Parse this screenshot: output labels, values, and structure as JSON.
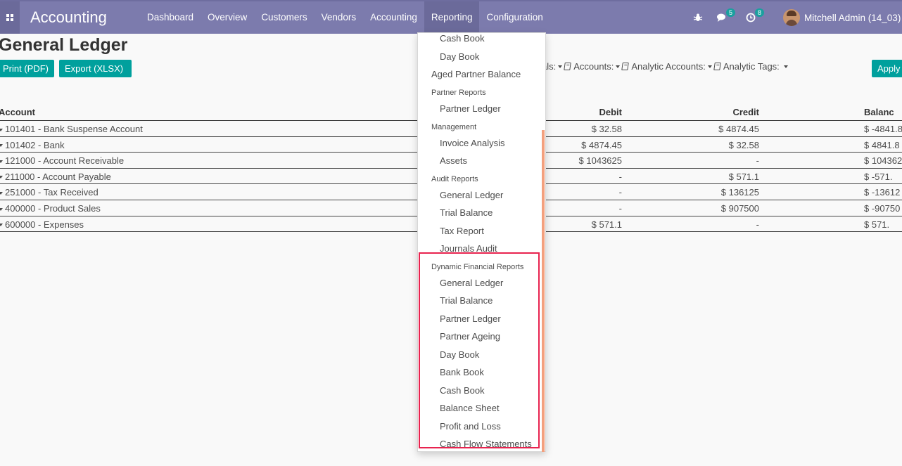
{
  "topbar": {
    "app_title": "Accounting",
    "menu": [
      "Dashboard",
      "Overview",
      "Customers",
      "Vendors",
      "Accounting",
      "Reporting",
      "Configuration"
    ],
    "active_menu": "Reporting",
    "messages_count": "5",
    "activities_count": "8",
    "user_name": "Mitchell Admin (14_03)"
  },
  "page": {
    "title": "General Ledger",
    "print_pdf_label": "Print (PDF)",
    "export_xlsx_label": "Export (XLSX)",
    "apply_label": "Apply",
    "filters": {
      "journals": "als:",
      "accounts": "Accounts:",
      "analytic_accounts": "Analytic Accounts:",
      "analytic_tags": "Analytic Tags:"
    }
  },
  "ledger": {
    "headers": {
      "account": "Account",
      "debit": "Debit",
      "credit": "Credit",
      "balance": "Balanc"
    },
    "rows": [
      {
        "account": "101401 - Bank Suspense Account",
        "debit": "$ 32.58",
        "credit": "$ 4874.45",
        "balance": "$ -4841.8"
      },
      {
        "account": "101402 - Bank",
        "debit": "$ 4874.45",
        "credit": "$ 32.58",
        "balance": "$ 4841.8"
      },
      {
        "account": "121000 - Account Receivable",
        "debit": "$ 1043625",
        "credit": "-",
        "balance": "$ 104362"
      },
      {
        "account": "211000 - Account Payable",
        "debit": "-",
        "credit": "$ 571.1",
        "balance": "$ -571."
      },
      {
        "account": "251000 - Tax Received",
        "debit": "-",
        "credit": "$ 136125",
        "balance": "$ -13612"
      },
      {
        "account": "400000 - Product Sales",
        "debit": "-",
        "credit": "$ 907500",
        "balance": "$ -90750"
      },
      {
        "account": "600000 - Expenses",
        "debit": "$ 571.1",
        "credit": "-",
        "balance": "$ 571."
      }
    ]
  },
  "dropdown": {
    "items": [
      {
        "kind": "sub",
        "label": "Cash Book"
      },
      {
        "kind": "sub",
        "label": "Day Book"
      },
      {
        "kind": "top",
        "label": "Aged Partner Balance"
      },
      {
        "kind": "header",
        "label": "Partner Reports"
      },
      {
        "kind": "sub",
        "label": "Partner Ledger"
      },
      {
        "kind": "header",
        "label": "Management"
      },
      {
        "kind": "sub",
        "label": "Invoice Analysis"
      },
      {
        "kind": "sub",
        "label": "Assets"
      },
      {
        "kind": "header",
        "label": "Audit Reports"
      },
      {
        "kind": "sub",
        "label": "General Ledger"
      },
      {
        "kind": "sub",
        "label": "Trial Balance"
      },
      {
        "kind": "sub",
        "label": "Tax Report"
      },
      {
        "kind": "sub",
        "label": "Journals Audit"
      },
      {
        "kind": "header",
        "label": "Dynamic Financial Reports"
      },
      {
        "kind": "sub",
        "label": "General Ledger"
      },
      {
        "kind": "sub",
        "label": "Trial Balance"
      },
      {
        "kind": "sub",
        "label": "Partner Ledger"
      },
      {
        "kind": "sub",
        "label": "Partner Ageing"
      },
      {
        "kind": "sub",
        "label": "Day Book"
      },
      {
        "kind": "sub",
        "label": "Bank Book"
      },
      {
        "kind": "sub",
        "label": "Cash Book"
      },
      {
        "kind": "sub",
        "label": "Balance Sheet"
      },
      {
        "kind": "sub",
        "label": "Profit and Loss"
      },
      {
        "kind": "sub",
        "label": "Cash Flow Statements"
      }
    ]
  },
  "colors": {
    "topbar": "#7c7bad",
    "primary_button": "#00a09d",
    "highlight_border": "#e8234f"
  }
}
